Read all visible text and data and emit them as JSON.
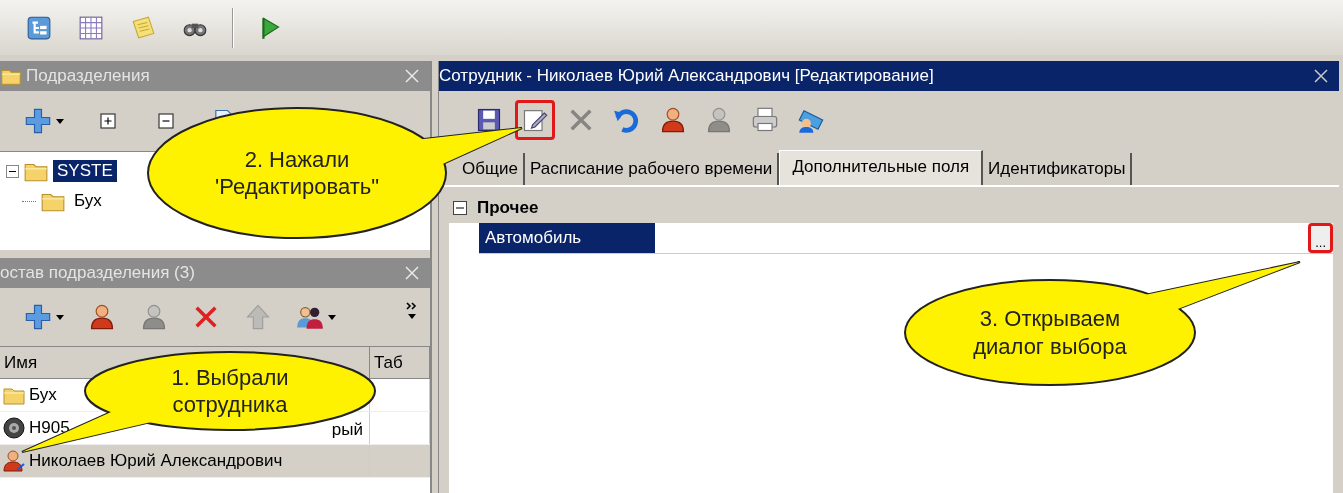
{
  "main_toolbar": {
    "buttons": [
      {
        "kind": "tree"
      },
      {
        "kind": "grid"
      },
      {
        "kind": "notes"
      },
      {
        "kind": "binoculars"
      },
      {
        "kind": "flag"
      }
    ]
  },
  "departments_panel": {
    "title": "Подразделения",
    "toolbar": [
      {
        "kind": "add",
        "dropdown": true
      },
      {
        "kind": "expand",
        "dropdown": false
      },
      {
        "kind": "collapse",
        "dropdown": false
      },
      {
        "kind": "document",
        "dropdown": false
      }
    ],
    "tree": [
      {
        "label": "SYSTE",
        "selected": true,
        "expanded": true,
        "children": [
          {
            "label": "Бух",
            "selected": false
          }
        ]
      }
    ]
  },
  "members_panel": {
    "title": "остав подразделения (3)",
    "toolbar": [
      {
        "kind": "add",
        "dropdown": true,
        "disabled": false
      },
      {
        "kind": "person",
        "dropdown": false,
        "disabled": false
      },
      {
        "kind": "person",
        "dropdown": false,
        "disabled": true
      },
      {
        "kind": "delete",
        "dropdown": false,
        "disabled": false
      },
      {
        "kind": "up",
        "dropdown": false,
        "disabled": true
      },
      {
        "kind": "people",
        "dropdown": true,
        "disabled": false
      }
    ],
    "columns": [
      "Имя",
      "Таб"
    ],
    "rows": [
      {
        "kind": "department",
        "name": "Бух",
        "selected": false
      },
      {
        "kind": "vehicle",
        "name": "H905",
        "name_tail": "рый",
        "selected": false
      },
      {
        "kind": "employee",
        "name": "Николаев Юрий Александрович",
        "selected": true
      }
    ]
  },
  "editor": {
    "title": "Сотрудник - Николаев Юрий Александрович [Редактирование]",
    "toolbar": [
      {
        "kind": "save",
        "disabled": false,
        "highlighted": false
      },
      {
        "kind": "edit",
        "disabled": false,
        "highlighted": true
      },
      {
        "kind": "delete",
        "disabled": true,
        "highlighted": false
      },
      {
        "kind": "undo",
        "disabled": false,
        "highlighted": false
      },
      {
        "kind": "person",
        "disabled": false,
        "highlighted": false
      },
      {
        "kind": "person",
        "disabled": true,
        "highlighted": false
      },
      {
        "kind": "print",
        "disabled": false,
        "highlighted": false
      },
      {
        "kind": "scan",
        "disabled": false,
        "highlighted": false
      }
    ],
    "tabs": [
      {
        "label": "Общие",
        "selected": false
      },
      {
        "label": "Расписание рабочего времени",
        "selected": false
      },
      {
        "label": "Дополнительные поля",
        "selected": true
      },
      {
        "label": "Идентификаторы",
        "selected": false
      }
    ],
    "categories": [
      {
        "label": "Прочее",
        "expanded": true,
        "properties": [
          {
            "label": "Автомобиль",
            "selected": true,
            "browse_button": {
              "label": "...",
              "highlighted": true
            }
          }
        ]
      }
    ]
  },
  "callouts": [
    {
      "text": "2. Нажали\n'Редактировать\""
    },
    {
      "text": "1. Выбрали\nсотрудника"
    },
    {
      "text": "3. Открываем\nдиалог выбора"
    }
  ]
}
